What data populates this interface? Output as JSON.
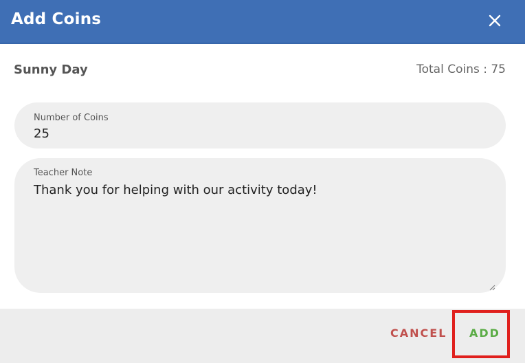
{
  "dialog": {
    "title": "Add Coins",
    "close_icon": "close-icon"
  },
  "info": {
    "student_name": "Sunny Day",
    "total_coins": "Total Coins : 75"
  },
  "fields": {
    "coins": {
      "label": "Number of Coins",
      "value": "25"
    },
    "note": {
      "label": "Teacher Note",
      "value": "Thank you for helping with our activity today!"
    }
  },
  "footer": {
    "cancel_label": "CANCEL",
    "add_label": "ADD"
  },
  "colors": {
    "header_bg": "#3f6fb5",
    "field_bg": "#efefef",
    "footer_bg": "#ededed",
    "cancel": "#c0504d",
    "add": "#5bac46",
    "highlight": "#e0201d"
  }
}
